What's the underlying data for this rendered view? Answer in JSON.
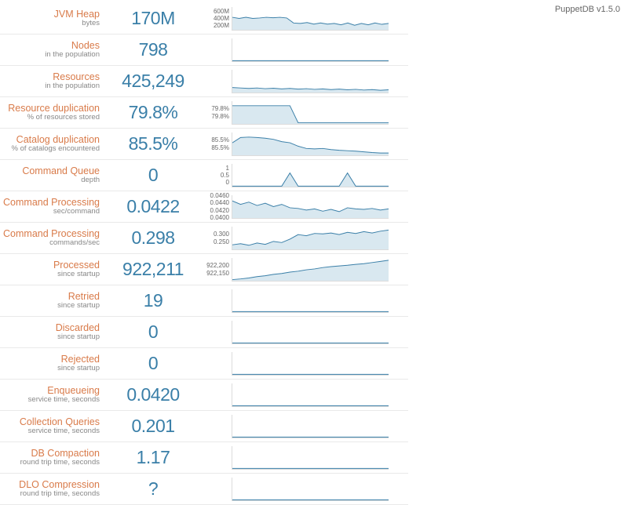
{
  "version": "PuppetDB v1.5.0",
  "metrics": [
    {
      "title": "JVM Heap",
      "sub": "bytes",
      "value": "170M",
      "yticks": [
        "600M",
        "400M",
        "200M"
      ],
      "spark": [
        0.55,
        0.5,
        0.55,
        0.5,
        0.52,
        0.55,
        0.53,
        0.55,
        0.52,
        0.3,
        0.28,
        0.32,
        0.25,
        0.3,
        0.25,
        0.28,
        0.22,
        0.3,
        0.2,
        0.28,
        0.22,
        0.3,
        0.24,
        0.28
      ]
    },
    {
      "title": "Nodes",
      "sub": "in the population",
      "value": "798",
      "yticks": [],
      "spark": [
        0.02,
        0.02,
        0.02,
        0.02,
        0.02,
        0.02,
        0.02,
        0.02,
        0.02,
        0.02,
        0.02,
        0.02,
        0.02,
        0.02,
        0.02,
        0.02,
        0.02,
        0.02,
        0.02,
        0.02
      ]
    },
    {
      "title": "Resources",
      "sub": "in the population",
      "value": "425,249",
      "yticks": [],
      "spark": [
        0.22,
        0.2,
        0.18,
        0.2,
        0.17,
        0.19,
        0.16,
        0.18,
        0.15,
        0.17,
        0.14,
        0.16,
        0.13,
        0.15,
        0.12,
        0.14,
        0.11,
        0.13,
        0.1,
        0.12
      ]
    },
    {
      "title": "Resource duplication",
      "sub": "% of resources stored",
      "value": "79.8%",
      "yticks": [
        "79.8%",
        "79.8%"
      ],
      "spark": [
        0.8,
        0.8,
        0.8,
        0.8,
        0.8,
        0.8,
        0.8,
        0.8,
        0.05,
        0.05,
        0.05,
        0.05,
        0.05,
        0.05,
        0.05,
        0.05,
        0.05,
        0.05,
        0.05,
        0.05
      ]
    },
    {
      "title": "Catalog duplication",
      "sub": "% of catalogs encountered",
      "value": "85.5%",
      "yticks": [
        "85.5%",
        "85.5%"
      ],
      "spark": [
        0.55,
        0.78,
        0.8,
        0.78,
        0.75,
        0.7,
        0.6,
        0.55,
        0.4,
        0.3,
        0.28,
        0.3,
        0.25,
        0.22,
        0.2,
        0.18,
        0.15,
        0.12,
        0.1,
        0.1
      ]
    },
    {
      "title": "Command Queue",
      "sub": "depth",
      "value": "0",
      "yticks": [
        "1",
        "0.5",
        "0"
      ],
      "spark": [
        0.02,
        0.02,
        0.02,
        0.02,
        0.02,
        0.02,
        0.02,
        0.6,
        0.02,
        0.02,
        0.02,
        0.02,
        0.02,
        0.02,
        0.6,
        0.02,
        0.02,
        0.02,
        0.02,
        0.02
      ]
    },
    {
      "title": "Command Processing",
      "sub": "sec/command",
      "value": "0.0422",
      "yticks": [
        "0.0460",
        "0.0440",
        "0.0420",
        "0.0400"
      ],
      "spark": [
        0.75,
        0.6,
        0.7,
        0.55,
        0.65,
        0.5,
        0.6,
        0.45,
        0.42,
        0.35,
        0.4,
        0.3,
        0.38,
        0.28,
        0.45,
        0.4,
        0.38,
        0.42,
        0.35,
        0.4
      ]
    },
    {
      "title": "Command Processing",
      "sub": "commands/sec",
      "value": "0.298",
      "yticks": [
        "0.300",
        "0.250"
      ],
      "spark": [
        0.2,
        0.25,
        0.18,
        0.28,
        0.22,
        0.35,
        0.3,
        0.45,
        0.65,
        0.6,
        0.7,
        0.68,
        0.72,
        0.65,
        0.75,
        0.7,
        0.78,
        0.72,
        0.8,
        0.85
      ]
    },
    {
      "title": "Processed",
      "sub": "since startup",
      "value": "922,211",
      "yticks": [
        "922,200",
        "922,150"
      ],
      "spark": [
        0.05,
        0.08,
        0.12,
        0.18,
        0.22,
        0.28,
        0.32,
        0.38,
        0.42,
        0.48,
        0.52,
        0.58,
        0.62,
        0.65,
        0.68,
        0.72,
        0.75,
        0.8,
        0.85,
        0.9
      ]
    },
    {
      "title": "Retried",
      "sub": "since startup",
      "value": "19",
      "yticks": [],
      "spark": [
        0.02,
        0.02,
        0.02,
        0.02,
        0.02,
        0.02,
        0.02,
        0.02,
        0.02,
        0.02,
        0.02,
        0.02,
        0.02,
        0.02,
        0.02,
        0.02,
        0.02,
        0.02,
        0.02,
        0.02
      ]
    },
    {
      "title": "Discarded",
      "sub": "since startup",
      "value": "0",
      "yticks": [],
      "spark": [
        0.02,
        0.02,
        0.02,
        0.02,
        0.02,
        0.02,
        0.02,
        0.02,
        0.02,
        0.02,
        0.02,
        0.02,
        0.02,
        0.02,
        0.02,
        0.02,
        0.02,
        0.02,
        0.02,
        0.02
      ]
    },
    {
      "title": "Rejected",
      "sub": "since startup",
      "value": "0",
      "yticks": [],
      "spark": [
        0.02,
        0.02,
        0.02,
        0.02,
        0.02,
        0.02,
        0.02,
        0.02,
        0.02,
        0.02,
        0.02,
        0.02,
        0.02,
        0.02,
        0.02,
        0.02,
        0.02,
        0.02,
        0.02,
        0.02
      ]
    },
    {
      "title": "Enqueueing",
      "sub": "service time, seconds",
      "value": "0.0420",
      "yticks": [],
      "spark": [
        0.02,
        0.02,
        0.02,
        0.02,
        0.02,
        0.02,
        0.02,
        0.02,
        0.02,
        0.02,
        0.02,
        0.02,
        0.02,
        0.02,
        0.02,
        0.02,
        0.02,
        0.02,
        0.02,
        0.02
      ]
    },
    {
      "title": "Collection Queries",
      "sub": "service time, seconds",
      "value": "0.201",
      "yticks": [],
      "spark": [
        0.02,
        0.02,
        0.02,
        0.02,
        0.02,
        0.02,
        0.02,
        0.02,
        0.02,
        0.02,
        0.02,
        0.02,
        0.02,
        0.02,
        0.02,
        0.02,
        0.02,
        0.02,
        0.02,
        0.02
      ]
    },
    {
      "title": "DB Compaction",
      "sub": "round trip time, seconds",
      "value": "1.17",
      "yticks": [],
      "spark": [
        0.02,
        0.02,
        0.02,
        0.02,
        0.02,
        0.02,
        0.02,
        0.02,
        0.02,
        0.02,
        0.02,
        0.02,
        0.02,
        0.02,
        0.02,
        0.02,
        0.02,
        0.02,
        0.02,
        0.02
      ]
    },
    {
      "title": "DLO Compression",
      "sub": "round trip time, seconds",
      "value": "?",
      "yticks": [],
      "spark": [
        0.02,
        0.02,
        0.02,
        0.02,
        0.02,
        0.02,
        0.02,
        0.02,
        0.02,
        0.02,
        0.02,
        0.02,
        0.02,
        0.02,
        0.02,
        0.02,
        0.02,
        0.02,
        0.02,
        0.02
      ]
    }
  ],
  "chart_data": {
    "type": "table",
    "title": "PuppetDB metrics dashboard",
    "rows": [
      {
        "metric": "JVM Heap",
        "unit": "bytes",
        "value": "170M"
      },
      {
        "metric": "Nodes",
        "unit": "in the population",
        "value": 798
      },
      {
        "metric": "Resources",
        "unit": "in the population",
        "value": 425249
      },
      {
        "metric": "Resource duplication",
        "unit": "% of resources stored",
        "value": "79.8%"
      },
      {
        "metric": "Catalog duplication",
        "unit": "% of catalogs encountered",
        "value": "85.5%"
      },
      {
        "metric": "Command Queue",
        "unit": "depth",
        "value": 0
      },
      {
        "metric": "Command Processing",
        "unit": "sec/command",
        "value": 0.0422
      },
      {
        "metric": "Command Processing",
        "unit": "commands/sec",
        "value": 0.298
      },
      {
        "metric": "Processed",
        "unit": "since startup",
        "value": 922211
      },
      {
        "metric": "Retried",
        "unit": "since startup",
        "value": 19
      },
      {
        "metric": "Discarded",
        "unit": "since startup",
        "value": 0
      },
      {
        "metric": "Rejected",
        "unit": "since startup",
        "value": 0
      },
      {
        "metric": "Enqueueing",
        "unit": "service time, seconds",
        "value": 0.042
      },
      {
        "metric": "Collection Queries",
        "unit": "service time, seconds",
        "value": 0.201
      },
      {
        "metric": "DB Compaction",
        "unit": "round trip time, seconds",
        "value": 1.17
      },
      {
        "metric": "DLO Compression",
        "unit": "round trip time, seconds",
        "value": "?"
      }
    ]
  }
}
